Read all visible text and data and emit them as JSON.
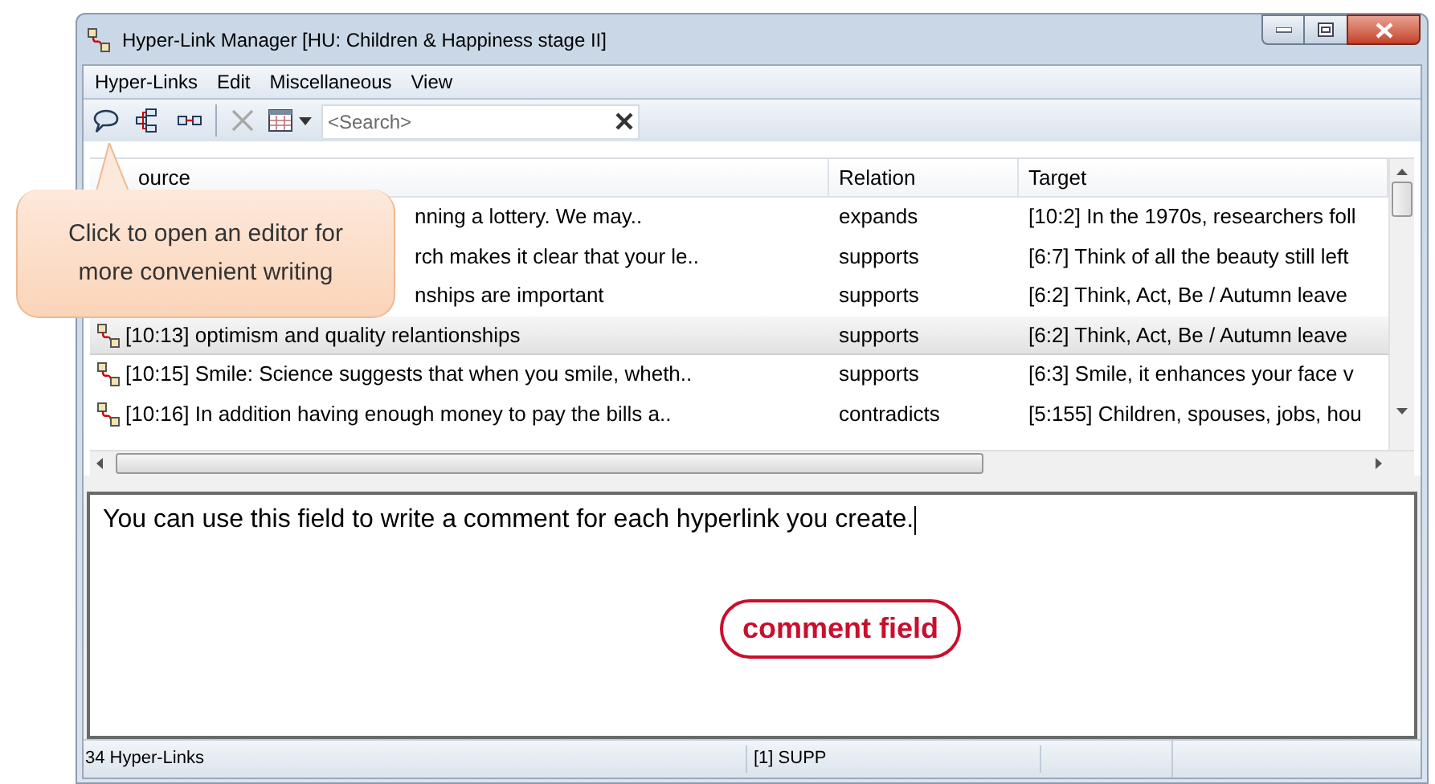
{
  "window": {
    "title": "Hyper-Link Manager [HU: Children & Happiness stage II]"
  },
  "menu": [
    "Hyper-Links",
    "Edit",
    "Miscellaneous",
    "View"
  ],
  "search": {
    "placeholder": "<Search>"
  },
  "callout": {
    "text": "Click to open an editor for more convenient writing"
  },
  "table": {
    "columns": [
      "ource",
      "Relation",
      "Target"
    ],
    "rows": [
      {
        "kind": "covered",
        "source": "nning a lottery. We may..",
        "relation": "expands",
        "target": "[10:2] In the 1970s, researchers foll",
        "selected": false
      },
      {
        "kind": "covered",
        "source": "rch makes it clear that your le..",
        "relation": "supports",
        "target": "[6:7] Think of all the beauty still left",
        "selected": false
      },
      {
        "kind": "covered",
        "source": "nships are important",
        "relation": "supports",
        "target": "[6:2] Think, Act, Be / Autumn leave",
        "selected": false
      },
      {
        "kind": "link",
        "source": "[10:13] optimism and quality relantionships",
        "relation": "supports",
        "target": "[6:2] Think, Act, Be / Autumn leave",
        "selected": true
      },
      {
        "kind": "link",
        "source": "[10:15] Smile: Science suggests that when you smile, wheth..",
        "relation": "supports",
        "target": "[6:3] Smile, it enhances your face v",
        "selected": false
      },
      {
        "kind": "link",
        "source": "[10:16] In addition having enough money to pay the bills a..",
        "relation": "contradicts",
        "target": "[5:155] Children, spouses, jobs, hou",
        "selected": false
      }
    ]
  },
  "comment": {
    "value": "You can use this field to write a comment for each hyperlink you create.",
    "annotation": "comment field"
  },
  "status_bar": [
    "34 Hyper-Links",
    "[1] SUPP"
  ]
}
